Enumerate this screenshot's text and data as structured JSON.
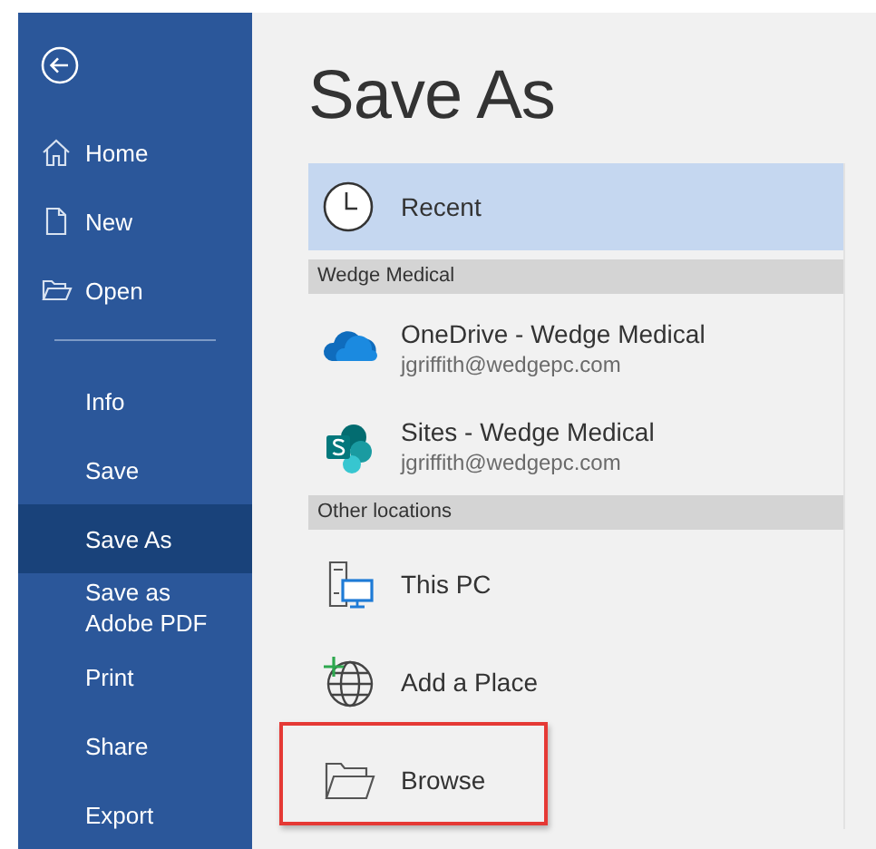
{
  "sidebar": {
    "primary_items": [
      {
        "label": "Home",
        "selected": false
      },
      {
        "label": "New",
        "selected": false
      },
      {
        "label": "Open",
        "selected": false
      }
    ],
    "items": [
      {
        "label": "Info",
        "selected": false
      },
      {
        "label": "Save",
        "selected": false
      },
      {
        "label": "Save As",
        "selected": true
      },
      {
        "label": "Save as Adobe PDF",
        "selected": false
      },
      {
        "label": "Print",
        "selected": false
      },
      {
        "label": "Share",
        "selected": false
      },
      {
        "label": "Export",
        "selected": false
      }
    ]
  },
  "title": "Save As",
  "recent": {
    "label": "Recent",
    "selected": true
  },
  "groups": [
    {
      "header": "Wedge Medical",
      "items": [
        {
          "name": "OneDrive - Wedge Medical",
          "detail": "jgriffith@wedgepc.com",
          "highlighted": false
        },
        {
          "name": "Sites - Wedge Medical",
          "detail": "jgriffith@wedgepc.com",
          "highlighted": false
        }
      ]
    },
    {
      "header": "Other locations",
      "items": [
        {
          "name": "This PC",
          "highlighted": false
        },
        {
          "name": "Add a Place",
          "highlighted": false
        },
        {
          "name": "Browse",
          "highlighted": true
        }
      ]
    }
  ]
}
